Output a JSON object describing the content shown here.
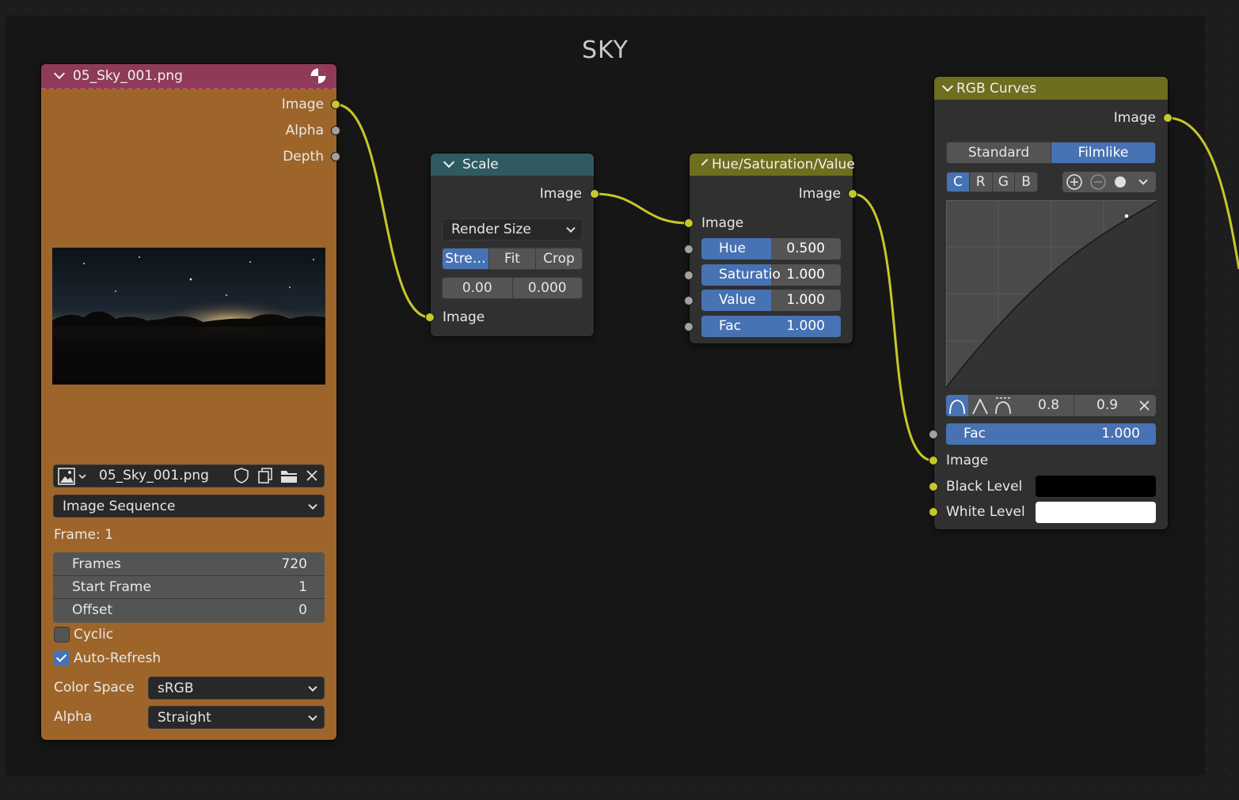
{
  "frame": {
    "title": "SKY"
  },
  "image_node": {
    "header": "05_Sky_001.png",
    "outputs": [
      "Image",
      "Alpha",
      "Depth"
    ],
    "image_name": "05_Sky_001.png",
    "source": "Image Sequence",
    "frame_label": "Frame: 1",
    "fields": [
      {
        "label": "Frames",
        "value": "720"
      },
      {
        "label": "Start Frame",
        "value": "1"
      },
      {
        "label": "Offset",
        "value": "0"
      }
    ],
    "cyclic": {
      "label": "Cyclic",
      "checked": false
    },
    "auto_refresh": {
      "label": "Auto-Refresh",
      "checked": true
    },
    "color_space": {
      "label": "Color Space",
      "value": "sRGB"
    },
    "alpha": {
      "label": "Alpha",
      "value": "Straight"
    },
    "colors": {
      "header": "#8f3a58",
      "body": "#9e652a"
    }
  },
  "scale_node": {
    "header": "Scale",
    "output": "Image",
    "space": "Render Size",
    "modes": [
      "Stre…",
      "Fit",
      "Crop"
    ],
    "active_mode": "Stre…",
    "offset_x": "0.00",
    "offset_y": "0.000",
    "input": "Image",
    "colors": {
      "header": "#2f5a5f"
    }
  },
  "hsv_node": {
    "header": "Hue/Saturation/Value",
    "output": "Image",
    "input": "Image",
    "sliders": [
      {
        "label": "Hue",
        "value": "0.500",
        "fill": 0.5
      },
      {
        "label": "Saturatio",
        "value": "1.000",
        "fill": 0.5
      },
      {
        "label": "Value",
        "value": "1.000",
        "fill": 0.5
      },
      {
        "label": "Fac",
        "value": "1.000",
        "fill": 1.0
      }
    ],
    "colors": {
      "header": "#6e6e1e"
    }
  },
  "curves_node": {
    "header": "RGB Curves",
    "output": "Image",
    "tone_modes": [
      "Standard",
      "Filmlike"
    ],
    "active_tone": "Filmlike",
    "channels": [
      "C",
      "R",
      "G",
      "B"
    ],
    "active_channel": "C",
    "handle_x": "0.8",
    "handle_y": "0.9",
    "fac": {
      "label": "Fac",
      "value": "1.000",
      "fill": 1.0
    },
    "inputs": {
      "image": "Image",
      "black": "Black Level",
      "white": "White Level"
    },
    "black_color": "#000000",
    "white_color": "#ffffff",
    "colors": {
      "header": "#6e6e1e"
    }
  }
}
